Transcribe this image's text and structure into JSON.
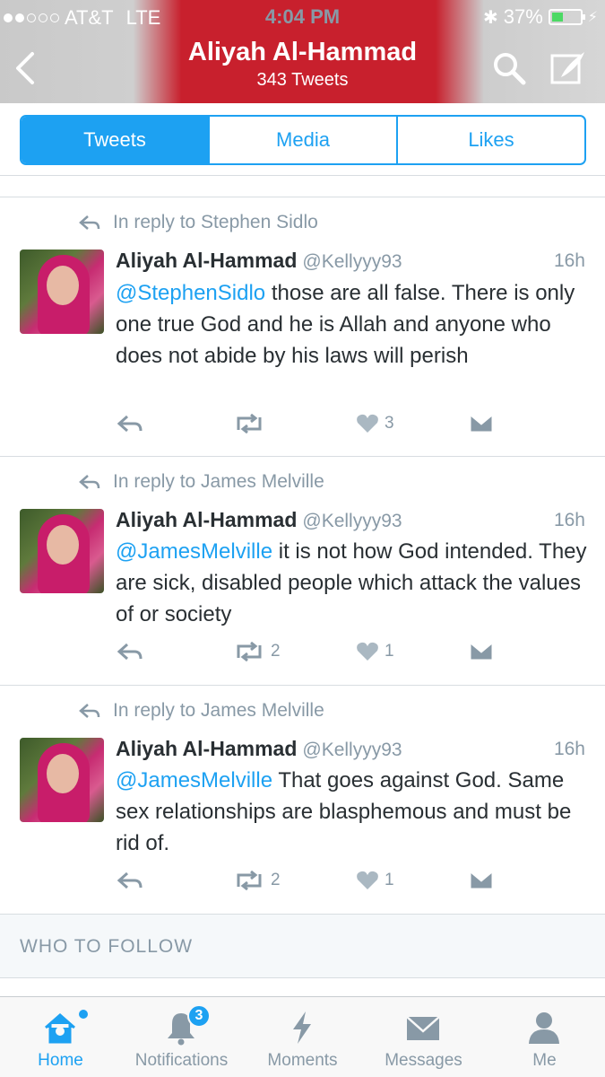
{
  "status_bar": {
    "carrier": "AT&T",
    "network": "LTE",
    "time": "4:04 PM",
    "battery": "37%"
  },
  "header": {
    "title": "Aliyah Al-Hammad",
    "subtitle": "343 Tweets"
  },
  "tabs": [
    {
      "label": "Tweets",
      "active": true
    },
    {
      "label": "Media",
      "active": false
    },
    {
      "label": "Likes",
      "active": false
    }
  ],
  "tweets": [
    {
      "reply_to": "In reply to Stephen Sidlo",
      "name": "Aliyah Al-Hammad",
      "handle": "@Kellyyy93",
      "time": "16h",
      "mention": "@StephenSidlo",
      "text": " those are all false. There is only one true God and he is Allah and anyone who does not abide by his laws will perish",
      "retweets": "",
      "likes": "3"
    },
    {
      "reply_to": "In reply to James Melville",
      "name": "Aliyah Al-Hammad",
      "handle": "@Kellyyy93",
      "time": "16h",
      "mention": "@JamesMelville",
      "text": " it is not how God intended. They are sick, disabled people which attack the values of or society",
      "retweets": "2",
      "likes": "1"
    },
    {
      "reply_to": "In reply to James Melville",
      "name": "Aliyah Al-Hammad",
      "handle": "@Kellyyy93",
      "time": "16h",
      "mention": "@JamesMelville",
      "text": " That goes against God. Same sex relationships are blasphemous and must be rid of.",
      "retweets": "2",
      "likes": "1"
    }
  ],
  "who_to_follow": {
    "label": "WHO TO FOLLOW"
  },
  "tab_bar": {
    "items": [
      {
        "label": "Home",
        "icon": "home-icon",
        "active": true
      },
      {
        "label": "Notifications",
        "icon": "bell-icon",
        "badge": "3"
      },
      {
        "label": "Moments",
        "icon": "lightning-icon"
      },
      {
        "label": "Messages",
        "icon": "envelope-icon"
      },
      {
        "label": "Me",
        "icon": "person-icon"
      }
    ]
  },
  "colors": {
    "accent": "#1da1f2",
    "header_red": "#c8202d",
    "muted": "#8899a6"
  }
}
